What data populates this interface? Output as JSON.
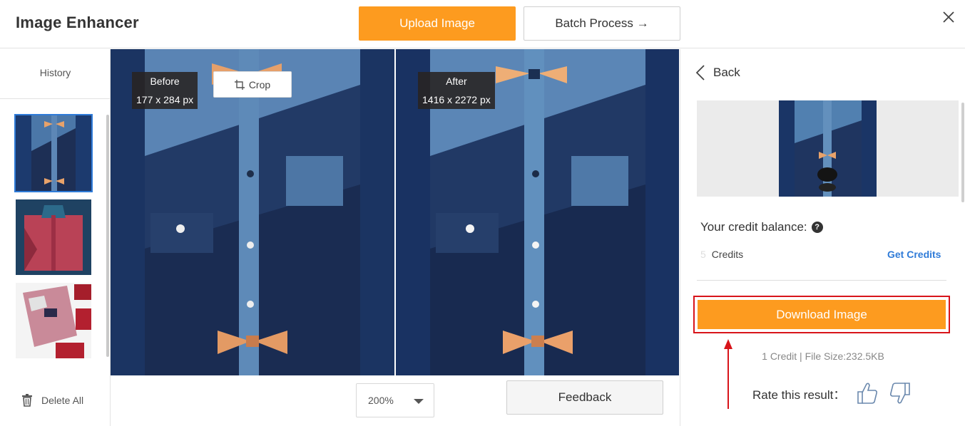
{
  "header": {
    "title": "Image Enhancer",
    "upload_label": "Upload Image",
    "batch_label": "Batch Process →"
  },
  "sidebar": {
    "history_label": "History",
    "thumbnails": [
      "denim shirt with bow tie",
      "red patterned shirt",
      "red checked shirt"
    ],
    "delete_all_label": "Delete All"
  },
  "preview": {
    "before": {
      "title": "Before",
      "size": "177 x 284 px"
    },
    "after": {
      "title": "After",
      "size": "1416 x 2272 px"
    },
    "crop_label": "Crop",
    "zoom_value": "200%",
    "feedback_label": "Feedback"
  },
  "right_panel": {
    "back_label": "Back",
    "credit_balance_label": "Your credit balance:",
    "credits_value": "5",
    "credits_label": "Credits",
    "get_credits_label": "Get Credits",
    "download_label": "Download Image",
    "file_info": "1 Credit | File Size:232.5KB",
    "rate_label": "Rate this result："
  },
  "colors": {
    "accent_orange": "#fd9b1f",
    "link_blue": "#2f7bd8",
    "highlight_red": "#d8141a",
    "preview_bg": "#1a3566"
  },
  "icons": [
    "close-icon",
    "crop-icon",
    "trash-icon",
    "back-chevron-icon",
    "help-icon",
    "thumbs-up-icon",
    "thumbs-down-icon",
    "dropdown-caret-icon"
  ]
}
